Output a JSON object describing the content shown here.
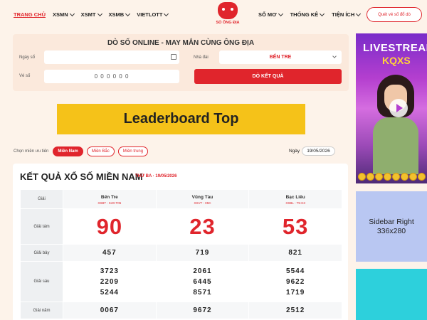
{
  "header": {
    "nav_left": [
      "TRANG CHỦ",
      "XSMN",
      "XSMT",
      "XSMB",
      "VIETLOTT"
    ],
    "logo_text": "SỔ ÔNG ĐỊA",
    "nav_right": [
      "SỔ MƠ",
      "THỐNG KÊ",
      "TIỆN ÍCH"
    ],
    "cta_label": "Quét vé số đổ dò"
  },
  "form": {
    "title": "DÒ SỐ ONLINE - MAY MẮN CÙNG ÔNG ĐỊA",
    "date_label": "Ngày sổ",
    "ticket_label": "Vé số",
    "ticket_placeholder": "0 0 0 0 0 0",
    "station_label": "Nhà đài",
    "station_value": "BẾN TRE",
    "submit_label": "DÒ KẾT QUẢ"
  },
  "banner": {
    "label": "Leaderboard Top"
  },
  "regions": {
    "label": "Chọn miền ưu tiên",
    "options": [
      "Miền Nam",
      "Miền Bắc",
      "Miền trung"
    ],
    "date_prefix": "Ngày",
    "date_value": "19/05/2026"
  },
  "results": {
    "title": "KẾT QUẢ XỔ SỐ MIỀN NAM",
    "subtitle": "THỨ BA  ·  19/05/2026",
    "header_label": "Giải",
    "provinces": [
      {
        "name": "Bến Tre",
        "code": "XSBT - K20-T05"
      },
      {
        "name": "Vũng Tàu",
        "code": "XSVT - 05C"
      },
      {
        "name": "Bạc Liêu",
        "code": "XSBL - T5-K3"
      }
    ],
    "rows": {
      "g8": {
        "label": "Giải tám",
        "values": [
          "90",
          "23",
          "53"
        ]
      },
      "g7": {
        "label": "Giải bảy",
        "values": [
          "457",
          "719",
          "821"
        ]
      },
      "g6": {
        "label": "Giải sáu",
        "values": [
          [
            "3723",
            "2209",
            "5244"
          ],
          [
            "2061",
            "6445",
            "8571"
          ],
          [
            "5544",
            "9622",
            "1719"
          ]
        ]
      },
      "g5": {
        "label": "Giải năm",
        "values": [
          "0067",
          "9672",
          "2512"
        ]
      }
    }
  },
  "sidebar": {
    "live_title": "LIVESTREAM",
    "live_brand": "KQXS",
    "ad_line1": "Sidebar Right",
    "ad_line2": "336x280"
  },
  "colors": {
    "accent": "#e0252c",
    "banner": "#f5c219",
    "background": "#fdf3ea"
  }
}
